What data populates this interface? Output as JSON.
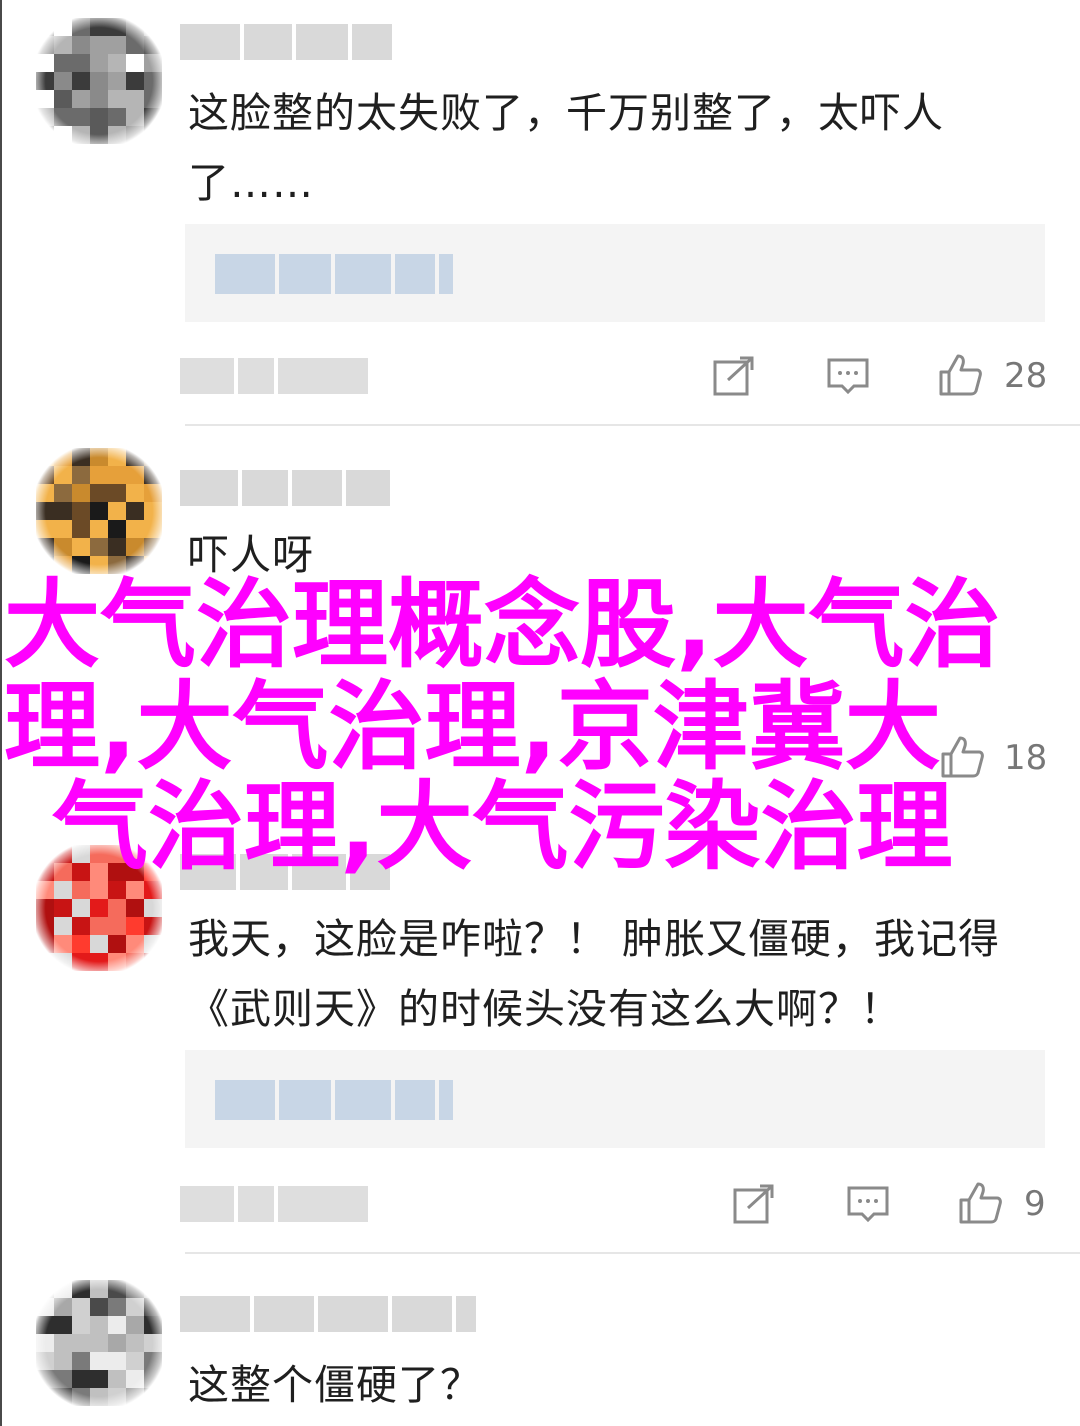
{
  "comments": [
    {
      "text": "这脸整的太失败了，千万别整了，太吓人了……",
      "like_count": "28",
      "avatar_colors": [
        "#3b3b3b",
        "#6b6b6b",
        "#8a8a8a",
        "#b5b5b5",
        "#5a5a5a",
        "#a0a0a0",
        "#ffffff"
      ]
    },
    {
      "text": "吓人呀",
      "like_count": "18",
      "avatar_colors": [
        "#3a2e22",
        "#c98a2d",
        "#f2b24a",
        "#6b4a26",
        "#1a1a1a",
        "#e6a03a",
        "#8c6a3e"
      ]
    },
    {
      "text": "我天，这脸是咋啦？！ 肿胀又僵硬，我记得《武则天》的时候头没有这么大啊？！",
      "like_count": "9",
      "avatar_colors": [
        "#e31a1a",
        "#ff3b2e",
        "#c81414",
        "#f56b5c",
        "#b01010",
        "#ff8a7a",
        "#d8d8d8"
      ]
    },
    {
      "text": "这整个僵硬了？",
      "like_count": "",
      "avatar_colors": [
        "#4a4a4a",
        "#7a7a7a",
        "#a8a8a8",
        "#d0d0d0",
        "#2e2e2e",
        "#c0c0c0",
        "#ececec"
      ]
    }
  ],
  "overlay": {
    "line1": "大气治理概念股,大气治",
    "line2": "理,大气治理,京津冀大",
    "line3": "气治理,大气污染治理"
  },
  "icons": [
    "share-icon",
    "reply-icon",
    "like-icon"
  ],
  "colors": {
    "overlay_text": "#ff00ff",
    "icon_gray": "#8a8a8a",
    "quote_bg": "#f4f4f4"
  }
}
